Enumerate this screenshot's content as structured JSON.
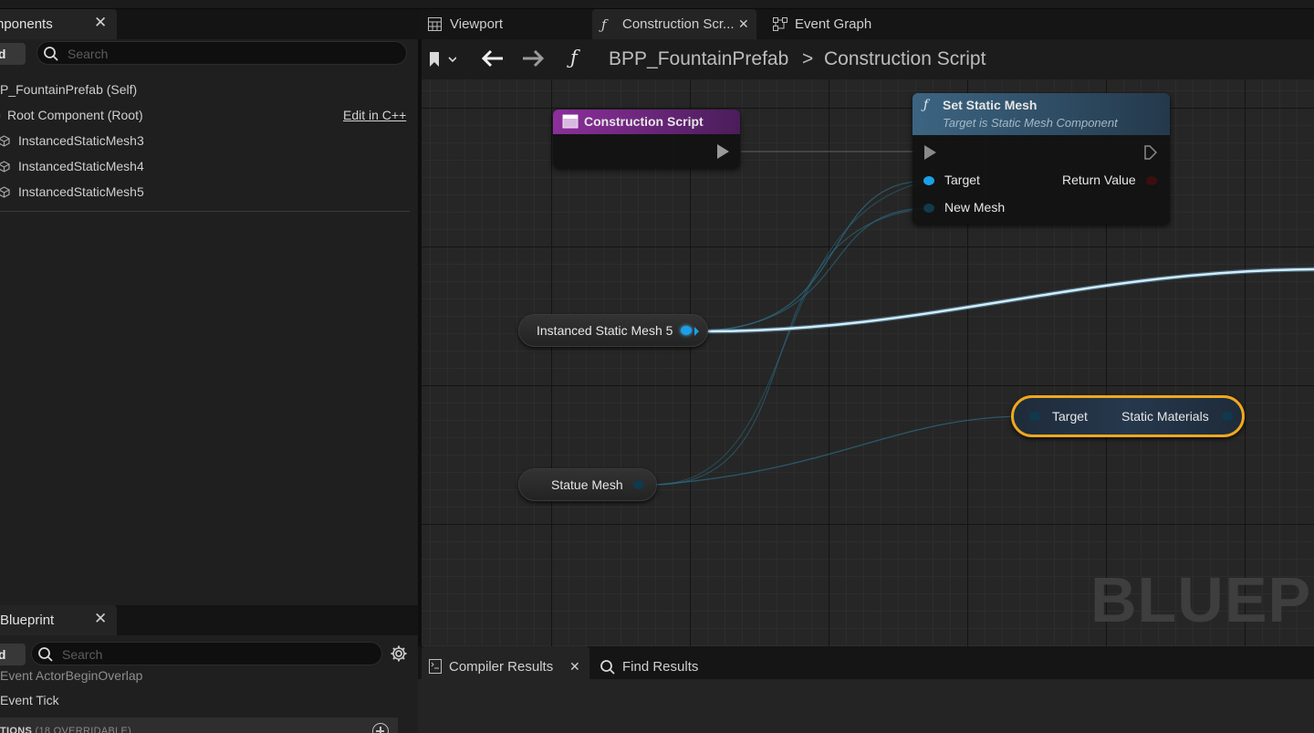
{
  "components_panel": {
    "tab_title": "nponents",
    "add_label": "ld",
    "search_placeholder": "Search",
    "items": [
      {
        "label": "P_FountainPrefab (Self)"
      },
      {
        "label": "Root Component (Root)",
        "action": "Edit in C++"
      },
      {
        "label": "InstancedStaticMesh3"
      },
      {
        "label": "InstancedStaticMesh4"
      },
      {
        "label": "InstancedStaticMesh5"
      }
    ]
  },
  "my_blueprint_panel": {
    "tab_title": "Blueprint",
    "add_label": "ld",
    "search_placeholder": "Search",
    "items": [
      {
        "label": "Event ActorBeginOverlap"
      },
      {
        "label": "Event Tick"
      }
    ],
    "category": {
      "label": "TIONS",
      "note": "(18 OVERRIDABLE)"
    }
  },
  "editor_tabs": [
    {
      "label": "Viewport",
      "icon": "viewport-grid-icon"
    },
    {
      "label": "Construction Scr...",
      "icon": "function-icon",
      "active": true
    },
    {
      "label": "Event Graph",
      "icon": "event-graph-icon"
    }
  ],
  "breadcrumb": {
    "root": "BPP_FountainPrefab",
    "separator": ">",
    "current": "Construction Script"
  },
  "graph": {
    "watermark": "BLUEPRI",
    "nodes": {
      "construction_script": {
        "title": "Construction Script",
        "color": "#7a2a8a"
      },
      "set_static_mesh": {
        "title": "Set Static Mesh",
        "subtitle": "Target is Static Mesh Component",
        "pins": {
          "target": "Target",
          "new_mesh": "New Mesh",
          "return_value": "Return Value"
        },
        "color": "#3c5a74"
      },
      "ism5_var": {
        "label": "Instanced Static Mesh 5"
      },
      "statue_var": {
        "label": "Statue Mesh"
      },
      "static_materials": {
        "target": "Target",
        "output": "Static Materials"
      }
    }
  },
  "bottom_tabs": [
    {
      "label": "Compiler Results",
      "icon": "compiler-results-icon",
      "active": true
    },
    {
      "label": "Find Results",
      "icon": "search-icon"
    }
  ],
  "colors": {
    "object_pin": "#1aa0e8",
    "selection_outline": "#f0a81e"
  }
}
